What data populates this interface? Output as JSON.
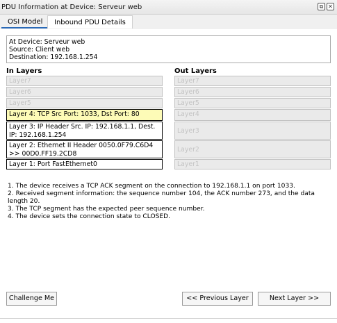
{
  "window": {
    "title": "PDU Information at Device: Serveur web",
    "icons": [
      "restore-icon",
      "close-icon"
    ]
  },
  "tabs": [
    {
      "label": "OSI Model",
      "active": true
    },
    {
      "label": "Inbound PDU Details",
      "active": false
    }
  ],
  "info": {
    "device": "At Device: Serveur web",
    "source": "Source: Client web",
    "destination": "Destination: 192.168.1.254"
  },
  "in_layers": {
    "label": "In Layers",
    "items": [
      "Layer7",
      "Layer6",
      "Layer5",
      "Layer 4: TCP Src Port: 1033, Dst Port: 80",
      "Layer 3: IP Header Src. IP: 192.168.1.1, Dest. IP: 192.168.1.254",
      "Layer 2: Ethernet II Header 0050.0F79.C6D4 >> 00D0.FF19.2CD8",
      "Layer 1: Port FastEthernet0"
    ]
  },
  "out_layers": {
    "label": "Out Layers",
    "items": [
      "Layer7",
      "Layer6",
      "Layer5",
      "Layer4",
      "Layer3",
      "Layer2",
      "Layer1"
    ]
  },
  "description": [
    "1. The device receives a TCP ACK segment on the connection to 192.168.1.1 on port 1033.",
    "2. Received segment information: the sequence number 104, the ACK number 273, and the data length 20.",
    "3. The TCP segment has the expected peer sequence number.",
    "4. The device sets the connection state to CLOSED."
  ],
  "buttons": {
    "challenge": "Challenge Me",
    "previous": "<< Previous Layer",
    "next": "Next Layer >>"
  }
}
